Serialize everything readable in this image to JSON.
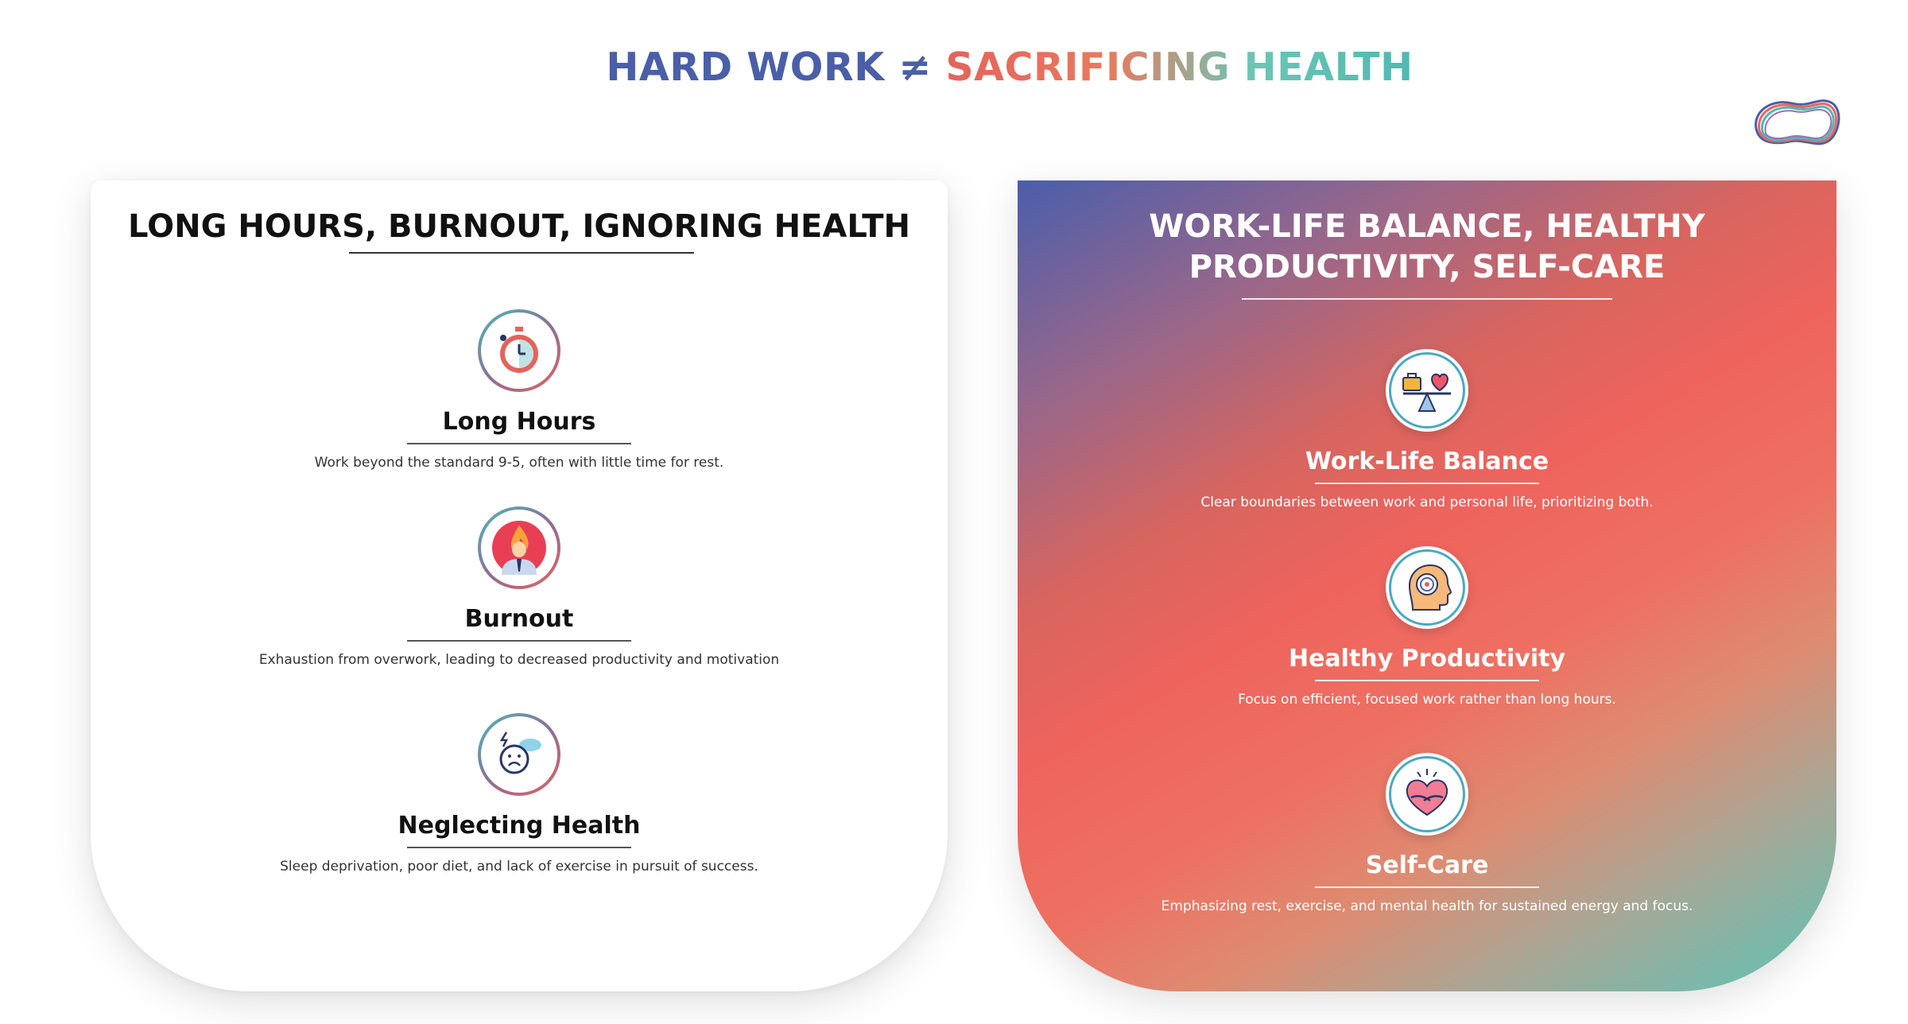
{
  "header": {
    "title_part1": "HARD WORK ≠",
    "title_part2": "SACRIFICING HEALTH"
  },
  "logo": {
    "icon": "brand-logo-icon"
  },
  "left_panel": {
    "title": "LONG HOURS, BURNOUT, IGNORING HEALTH",
    "items": [
      {
        "icon": "stopwatch-icon",
        "title": "Long Hours",
        "description": "Work beyond the standard 9-5, often with little time for rest."
      },
      {
        "icon": "burnout-icon",
        "title": "Burnout",
        "description": "Exhaustion from overwork, leading to decreased productivity and motivation"
      },
      {
        "icon": "sad-face-icon",
        "title": "Neglecting Health",
        "description": "Sleep deprivation, poor diet, and lack of exercise in pursuit of success."
      }
    ]
  },
  "right_panel": {
    "title_line1": "WORK-LIFE BALANCE, HEALTHY",
    "title_line2": "PRODUCTIVITY, SELF-CARE",
    "items": [
      {
        "icon": "balance-scale-icon",
        "title": "Work-Life Balance",
        "description": "Clear boundaries between work and personal life, prioritizing both."
      },
      {
        "icon": "focused-mind-icon",
        "title": "Healthy Productivity",
        "description": "Focus on efficient, focused work rather than long hours."
      },
      {
        "icon": "self-hug-heart-icon",
        "title": "Self-Care",
        "description": "Emphasizing rest, exercise, and mental health for sustained energy and focus."
      }
    ]
  },
  "colors": {
    "navy": "#4a5fa8",
    "coral": "#ee645d",
    "teal": "#4fb9b2"
  }
}
